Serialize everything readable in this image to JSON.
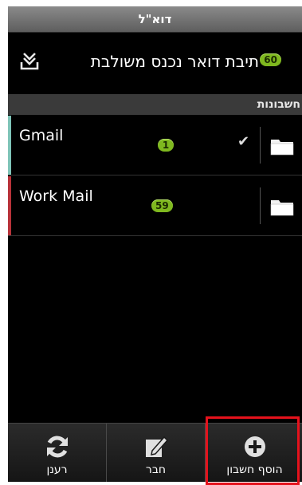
{
  "title_bar": {
    "title": "דוא\"ל"
  },
  "combined_inbox": {
    "count": "60",
    "label": "תיבת דואר נכנס משולבת",
    "icon": "inbox-download-icon"
  },
  "section": {
    "title": "חשבונות"
  },
  "accounts": [
    {
      "name": "Gmail",
      "count": "1",
      "color": "#7fc4b8",
      "selected": true,
      "icon": "folder-icon"
    },
    {
      "name": "Work Mail",
      "count": "59",
      "color": "#b8333a",
      "selected": false,
      "icon": "folder-icon"
    }
  ],
  "toolbar": {
    "items": [
      {
        "label": "רענן",
        "icon": "refresh-icon"
      },
      {
        "label": "חבר",
        "icon": "compose-icon"
      },
      {
        "label": "הוסף חשבון",
        "icon": "add-circle-icon"
      }
    ]
  },
  "colors": {
    "badge": "#7fb81f",
    "highlight": "#e5121c"
  }
}
